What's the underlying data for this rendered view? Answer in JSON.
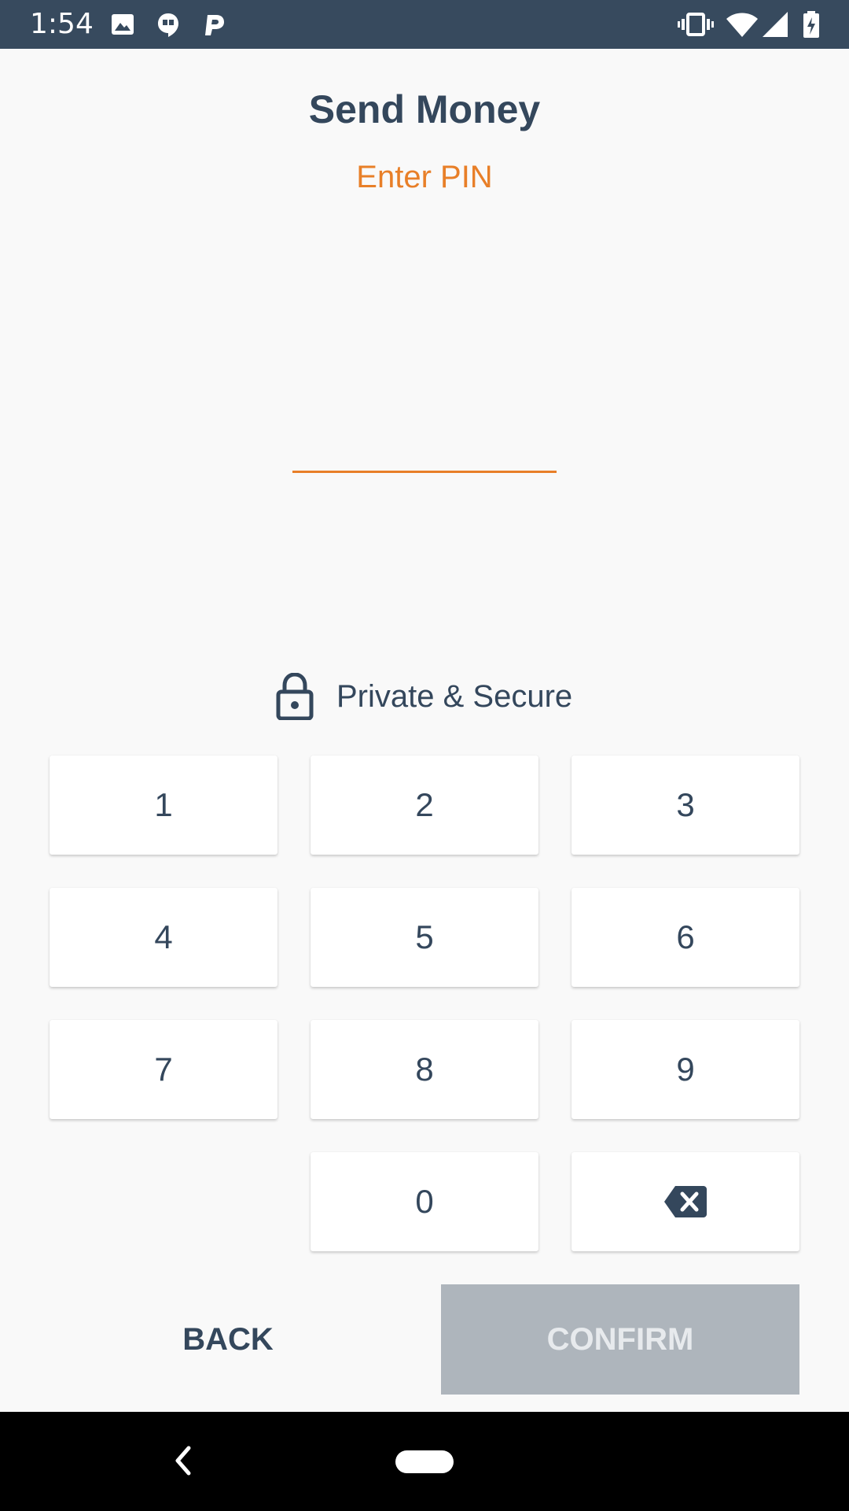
{
  "status_bar": {
    "time": "1:54",
    "left_icons": [
      "image-icon",
      "hangouts-icon",
      "p-app-icon"
    ],
    "right_icons": [
      "vibrate-icon",
      "wifi-icon",
      "signal-icon",
      "battery-charging-icon"
    ]
  },
  "header": {
    "title": "Send Money",
    "subtitle": "Enter PIN"
  },
  "pin_field": {
    "value": ""
  },
  "security": {
    "icon": "lock-icon",
    "label": "Private & Secure"
  },
  "keypad": {
    "keys": [
      "1",
      "2",
      "3",
      "4",
      "5",
      "6",
      "7",
      "8",
      "9",
      "0"
    ],
    "backspace_icon": "backspace-icon"
  },
  "actions": {
    "back_label": "BACK",
    "confirm_label": "CONFIRM"
  },
  "colors": {
    "accent": "#e87f28",
    "text": "#34475c",
    "status_bar": "#374a5e",
    "confirm_disabled": "#aeb5bc"
  },
  "nav_bar": {
    "icons": [
      "nav-back-icon",
      "nav-home-icon"
    ]
  }
}
